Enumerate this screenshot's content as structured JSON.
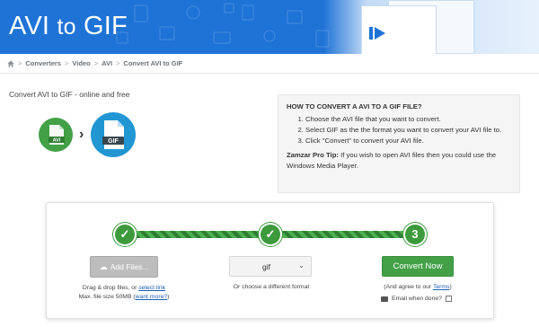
{
  "header": {
    "title_a": "AVI",
    "title_to": "to",
    "title_b": "GIF"
  },
  "breadcrumb": {
    "items": [
      "Converters",
      "Video",
      "AVI",
      "Convert AVI to GIF"
    ],
    "separator": ">"
  },
  "main": {
    "subtitle": "Convert AVI to GIF - online and free",
    "source_badge": "AVI",
    "target_badge": "GIF"
  },
  "howto": {
    "heading": "HOW TO CONVERT A AVI TO A GIF FILE?",
    "steps": [
      "Choose the AVI file that you want to convert.",
      "Select GIF as the the format you want to convert your AVI file to.",
      "Click \"Convert\" to convert your AVI file."
    ],
    "tip_label": "Zamzar Pro Tip:",
    "tip_text": " If you wish to open AVI files then you could use the Windows Media Player."
  },
  "converter": {
    "step1": "✓",
    "step2": "✓",
    "step3": "3",
    "add_files_label": "Add Files...",
    "drop_text": "Drag & drop files, or ",
    "select_link": "select link",
    "max_size": "Max. file size 50MB (",
    "want_more": "want more?",
    "max_size_close": ")",
    "format_value": "gif",
    "format_hint": "Or choose a different format",
    "convert_label": "Convert Now",
    "terms_prefix": "(And agree to our ",
    "terms_link": "Terms",
    "terms_suffix": ")",
    "email_label": "Email when done?"
  },
  "colors": {
    "banner": "#1f73d6",
    "step_green": "#3d9a3d",
    "convert_green": "#43a047",
    "link_blue": "#1a5fb4"
  }
}
